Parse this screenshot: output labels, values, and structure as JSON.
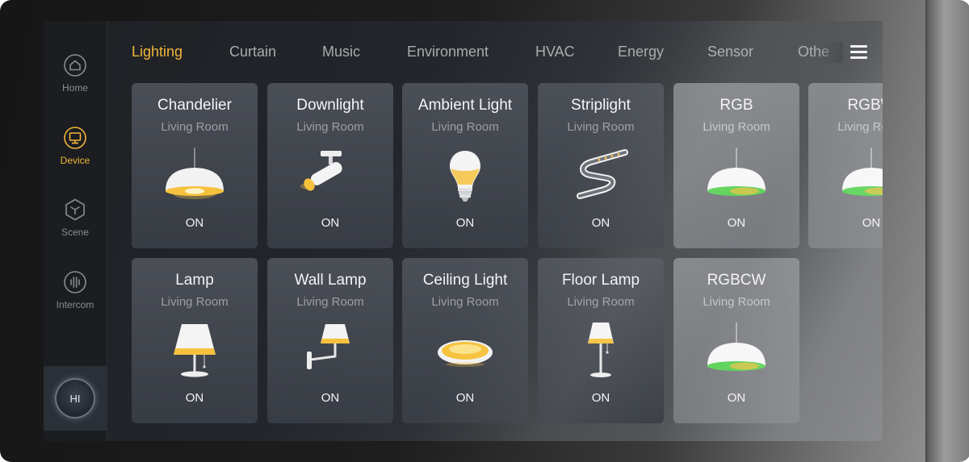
{
  "sidebar": {
    "items": [
      {
        "label": "Home",
        "icon": "home-icon",
        "active": false
      },
      {
        "label": "Device",
        "icon": "device-icon",
        "active": true
      },
      {
        "label": "Scene",
        "icon": "scene-icon",
        "active": false
      },
      {
        "label": "Intercom",
        "icon": "intercom-icon",
        "active": false
      }
    ],
    "assistant_label": "HI"
  },
  "tabs": [
    {
      "label": "Lighting",
      "active": true
    },
    {
      "label": "Curtain",
      "active": false
    },
    {
      "label": "Music",
      "active": false
    },
    {
      "label": "Environment",
      "active": false
    },
    {
      "label": "HVAC",
      "active": false
    },
    {
      "label": "Energy",
      "active": false
    },
    {
      "label": "Sensor",
      "active": false
    },
    {
      "label": "Othe",
      "active": false
    }
  ],
  "devices": [
    {
      "name": "Chandelier",
      "room": "Living Room",
      "status": "ON",
      "icon": "chandelier-icon"
    },
    {
      "name": "Downlight",
      "room": "Living Room",
      "status": "ON",
      "icon": "downlight-icon"
    },
    {
      "name": "Ambient Light",
      "room": "Living Room",
      "status": "ON",
      "icon": "bulb-icon"
    },
    {
      "name": "Striplight",
      "room": "Living Room",
      "status": "ON",
      "icon": "striplight-icon"
    },
    {
      "name": "RGB",
      "room": "Living Room",
      "status": "ON",
      "icon": "rgb-pendant-icon"
    },
    {
      "name": "RGBW",
      "room": "Living Room",
      "status": "ON",
      "icon": "rgb-pendant-icon"
    },
    {
      "name": "Lamp",
      "room": "Living Room",
      "status": "ON",
      "icon": "table-lamp-icon"
    },
    {
      "name": "Wall Lamp",
      "room": "Living Room",
      "status": "ON",
      "icon": "wall-lamp-icon"
    },
    {
      "name": "Ceiling Light",
      "room": "Living Room",
      "status": "ON",
      "icon": "ceiling-light-icon"
    },
    {
      "name": "Floor Lamp",
      "room": "Living Room",
      "status": "ON",
      "icon": "floor-lamp-icon"
    },
    {
      "name": "RGBCW",
      "room": "Living Room",
      "status": "ON",
      "icon": "rgb-pendant-icon"
    }
  ],
  "colors": {
    "accent": "#f1b53a",
    "glow": "#f6c23e",
    "rgb_green": "#5ed35a"
  }
}
